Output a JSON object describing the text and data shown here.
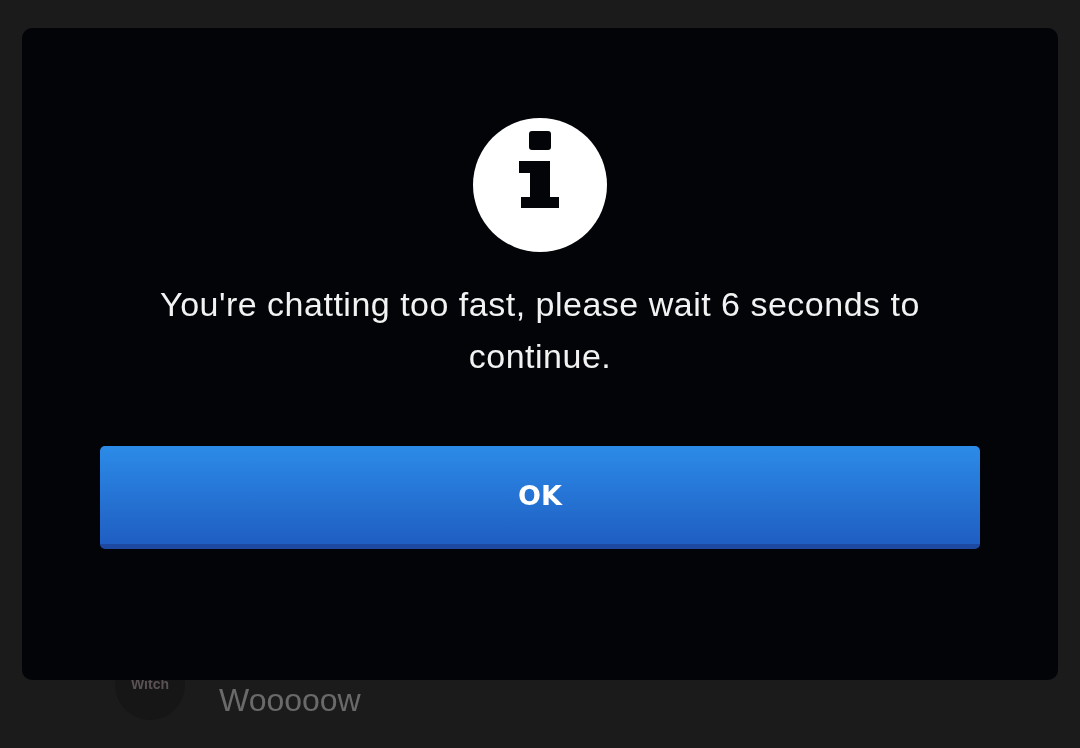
{
  "chat_message": {
    "author": "Witch",
    "text": "Wooooow"
  },
  "dialog": {
    "message": "You're chatting too fast, please wait 6 seconds to continue.",
    "button": "OK"
  }
}
